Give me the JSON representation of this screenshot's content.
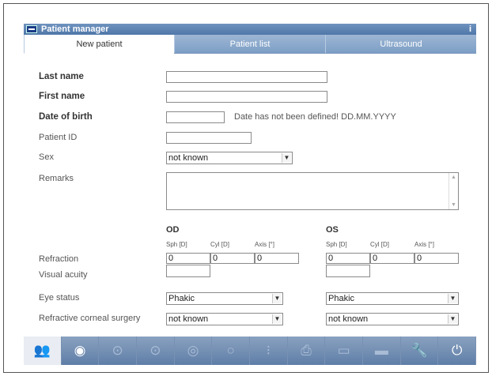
{
  "app": {
    "title": "Patient manager",
    "info_symbol": "i"
  },
  "tabs": [
    {
      "label": "New patient",
      "active": true
    },
    {
      "label": "Patient list",
      "active": false
    },
    {
      "label": "Ultrasound",
      "active": false
    }
  ],
  "form": {
    "last_name": {
      "label": "Last name",
      "value": ""
    },
    "first_name": {
      "label": "First name",
      "value": ""
    },
    "dob": {
      "label": "Date of birth",
      "value": "",
      "hint": "Date has not been defined! DD.MM.YYYY"
    },
    "patient_id": {
      "label": "Patient ID",
      "value": ""
    },
    "sex": {
      "label": "Sex",
      "value": "not known"
    },
    "remarks": {
      "label": "Remarks",
      "value": ""
    },
    "refraction_label": "Refraction",
    "visual_acuity_label": "Visual acuity",
    "eye_status_label": "Eye status",
    "refractive_surgery_label": "Refractive corneal surgery"
  },
  "eyes": {
    "od": {
      "title": "OD",
      "col_sph": "Sph [D]",
      "col_cyl": "Cyl [D]",
      "col_axis": "Axis [°]",
      "sph": "0",
      "cyl": "0",
      "axis": "0",
      "visual_acuity": "",
      "eye_status": "Phakic",
      "refractive_surgery": "not known"
    },
    "os": {
      "title": "OS",
      "col_sph": "Sph [D]",
      "col_cyl": "Cyl [D]",
      "col_axis": "Axis [°]",
      "sph": "0",
      "cyl": "0",
      "axis": "0",
      "visual_acuity": "",
      "eye_status": "Phakic",
      "refractive_surgery": "not known"
    }
  },
  "dropdown_arrow": "▼",
  "scroll_up": "▲",
  "scroll_down": "▼",
  "toolbar": [
    {
      "icon": "patient-icon",
      "glyph": "👥",
      "active": true
    },
    {
      "icon": "eye-icon",
      "glyph": "◉",
      "active": false
    },
    {
      "icon": "eye-measure-left-icon",
      "glyph": "⊙",
      "active": false
    },
    {
      "icon": "eye-measure-right-icon",
      "glyph": "⊙",
      "active": false
    },
    {
      "icon": "target-icon",
      "glyph": "◎",
      "active": false
    },
    {
      "icon": "circle-icon",
      "glyph": "○",
      "active": false
    },
    {
      "icon": "iol-icon",
      "glyph": "⁝",
      "active": false
    },
    {
      "icon": "printer-icon",
      "glyph": "⎙",
      "active": false
    },
    {
      "icon": "laptop-icon",
      "glyph": "▭",
      "active": false
    },
    {
      "icon": "usb-icon",
      "glyph": "▬",
      "active": false
    },
    {
      "icon": "wrench-icon",
      "glyph": "🔧",
      "active": false
    },
    {
      "icon": "power-icon",
      "glyph": "⏻",
      "active": false
    }
  ]
}
